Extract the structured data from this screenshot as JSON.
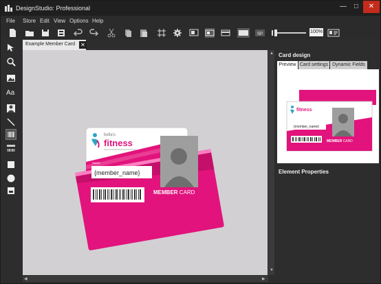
{
  "window": {
    "title": "DesignStudio: Professional",
    "controls": {
      "minimize": "—",
      "maximize": "□",
      "close": "✕"
    }
  },
  "menu": [
    "File",
    "Store",
    "Edit",
    "View",
    "Options",
    "Help"
  ],
  "toolbar": {
    "zoom": "100%",
    "icons": [
      "new-file-icon",
      "open-folder-icon",
      "save-icon",
      "save-all-icon",
      "undo-icon",
      "redo-icon",
      "cut-icon",
      "copy-icon",
      "paste-icon",
      "grid-icon",
      "settings-gear-icon",
      "card-layout-icon",
      "card-front-icon",
      "card-back-icon",
      "card-blank-icon",
      "sp-icon",
      "zoom-slider",
      "contact-card-icon"
    ]
  },
  "left_tools": [
    "pointer-tool-icon",
    "zoom-tool-icon",
    "image-tool-icon",
    "text-tool-icon",
    "photo-tool-icon",
    "line-tool-icon",
    "barcode-tool-icon",
    "magstripe-tool-icon",
    "rectangle-tool-icon",
    "ellipse-tool-icon",
    "layers-tool-icon"
  ],
  "document_tab": {
    "label": "Example Member Card",
    "close": "✕"
  },
  "card": {
    "brand_small": "bella's",
    "brand": "fitness",
    "name_label": "NAME",
    "name_value": "{member_name}",
    "member_card_bold": "MEMBER",
    "member_card_rest": " CARD"
  },
  "right_panel": {
    "title": "Card design",
    "tabs": [
      "Preview",
      "Card settings",
      "Dynamic Fields"
    ],
    "active_tab": "Preview",
    "preview_card": {
      "brand": "fitness",
      "name_value": "{member_name}",
      "member_card_bold": "MEMBER",
      "member_card_rest": " CARD"
    },
    "element_properties_title": "Element Properties"
  },
  "colors": {
    "accent_pink": "#e2137c",
    "dark_pink": "#b00e62",
    "canvas": "#d2d0d3",
    "teal": "#2aa6c2"
  }
}
